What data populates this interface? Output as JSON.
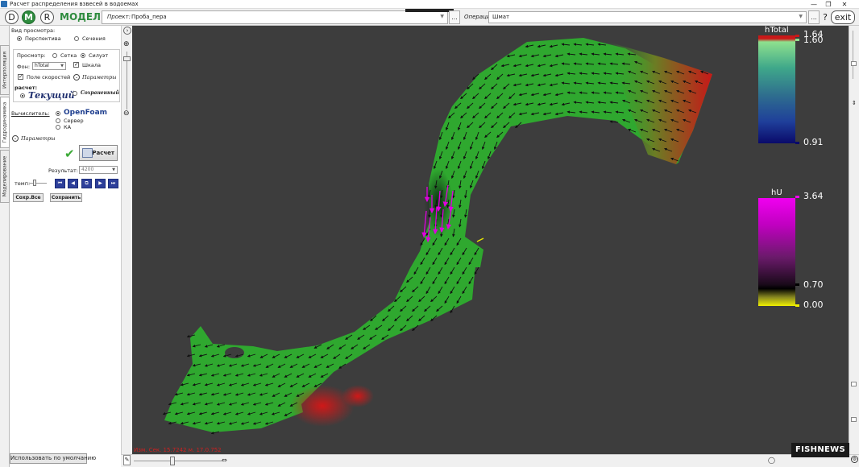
{
  "window": {
    "title": "Расчет распределения взвесей в водоемах",
    "controls": [
      "—",
      "❐",
      "✕"
    ]
  },
  "toolbar": {
    "buttons": [
      "D",
      "M",
      "R"
    ],
    "active_button": "M",
    "model_title": "МОДЕЛЬ",
    "project_label": "Проект:",
    "project_value": "Проба_пера",
    "browse_label": "...",
    "operation_label": "Операция:",
    "operation_value": "Шмат",
    "help_label": "?",
    "exit_label": "exit"
  },
  "tabs": [
    "Интерполяция",
    "Гидродинамика",
    "Моделирование"
  ],
  "left": {
    "view_mode_label": "Вид просмотра:",
    "view_mode_options": [
      "Перспектива",
      "Сечения"
    ],
    "view_label": "Просмотр:",
    "view_options": [
      "Сетка",
      "Силуэт"
    ],
    "background_label": "Фон:",
    "background_value": "hTotal",
    "scale_label": "Шкала",
    "velocity_label": "Поле скоростей",
    "params_label": "Параметры",
    "calc_label": "расчет:",
    "current_label": "Текущий",
    "saved_label": "Сохраненный",
    "solver_label": "Вычислитель:",
    "solver_options": [
      "OpenFoam",
      "Сервер",
      "КА"
    ],
    "params2_label": "Параметры",
    "calc_button": "Расчет",
    "result_label": "Результат:",
    "result_value": "4200",
    "tempo_label": "темп:",
    "nav_buttons": [
      "⏮",
      "◀",
      "⧉",
      "▶",
      "⏭"
    ],
    "save_all_label": "Сохр.Все",
    "save_label": "Сохранить",
    "default_button": "Использовать по умолчанию"
  },
  "legend": {
    "total": {
      "title": "hTotal",
      "max_label": "1.64",
      "mid_label": "1.60",
      "min_label": "0.91"
    },
    "velocity": {
      "title": "hU",
      "max_label": "3.64",
      "mid_label": "0.70",
      "min_label": "0.00"
    }
  },
  "status": {
    "text": "Изм. Сек. 15.7242 м. 17.0.752"
  },
  "watermark": {
    "text": "FISHNEWS"
  },
  "colors": {
    "accent": "#2e8b3e",
    "viewport_bg": "#3d3d3d",
    "river_green": "#2fa82f",
    "river_red": "#c81818",
    "velocity_magenta": "#e000e0"
  }
}
